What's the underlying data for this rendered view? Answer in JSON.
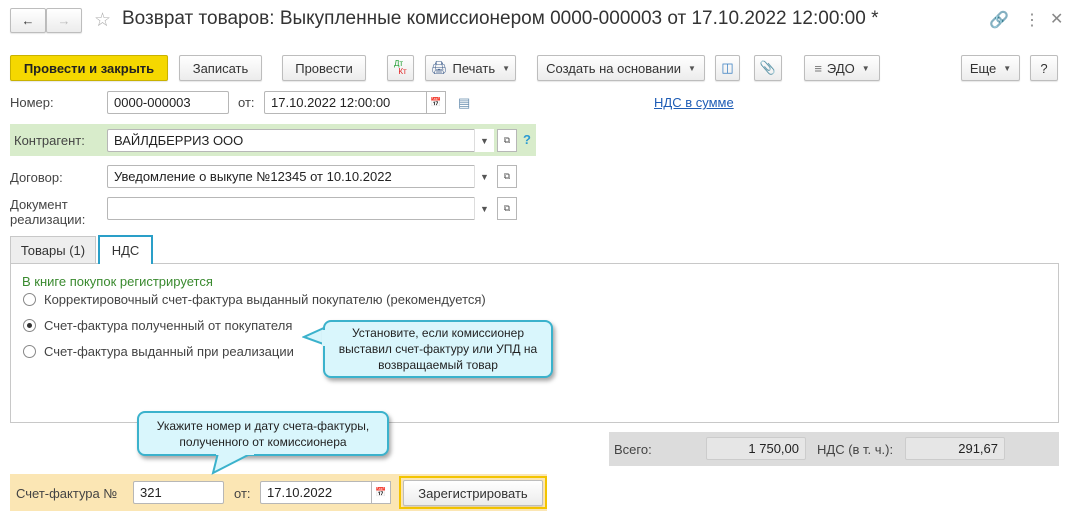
{
  "window": {
    "title": "Возврат товаров: Выкупленные комиссионером 0000-000003 от 17.10.2022 12:00:00 *"
  },
  "toolbar": {
    "post_close": "Провести и закрыть",
    "save": "Записать",
    "post": "Провести",
    "dtkt_dt": "Дт",
    "dtkt_kt": "Кт",
    "print": "Печать",
    "create_based": "Создать на основании",
    "edo": "ЭДО",
    "more": "Еще",
    "help": "?"
  },
  "header": {
    "number_label": "Номер:",
    "number": "0000-000003",
    "date_label": "от:",
    "date": "17.10.2022 12:00:00",
    "vat_link": "НДС в сумме"
  },
  "counterparty": {
    "label": "Контрагент:",
    "value": "ВАЙЛДБЕРРИЗ ООО",
    "help": "?"
  },
  "contract": {
    "label": "Договор:",
    "value": "Уведомление о выкупе №12345 от 10.10.2022"
  },
  "sale_doc": {
    "label": "Документ реализации:",
    "value": ""
  },
  "tabs": [
    {
      "label": "Товары (1)",
      "active": false
    },
    {
      "label": "НДС",
      "active": true
    }
  ],
  "vat_tab": {
    "heading": "В книге покупок регистрируется",
    "options": [
      {
        "label": "Корректировочный счет-фактура выданный покупателю (рекомендуется)",
        "selected": false
      },
      {
        "label": "Счет-фактура полученный от покупателя",
        "selected": true
      },
      {
        "label": "Счет-фактура выданный при реализации",
        "selected": false
      }
    ]
  },
  "callouts": {
    "first": "Установите, если комиссионер выставил счет-фактуру или УПД на возвращаемый товар",
    "second": "Укажите номер и дату счета-фактуры, полученного от комиссионера"
  },
  "totals": {
    "total_label": "Всего:",
    "total": "1 750,00",
    "vat_label": "НДС (в т. ч.):",
    "vat": "291,67"
  },
  "invoice": {
    "label": "Счет-фактура №",
    "number": "321",
    "date_label": "от:",
    "date": "17.10.2022",
    "register": "Зарегистрировать"
  }
}
